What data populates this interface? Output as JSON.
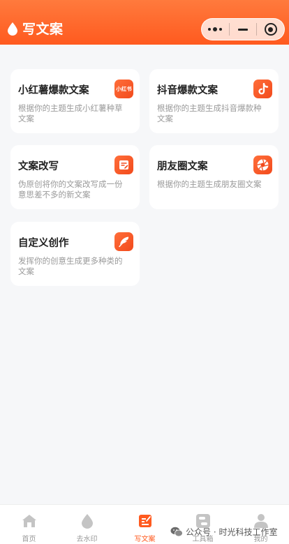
{
  "header": {
    "title": "写文案",
    "logo_icon": "water-drop-icon",
    "capsule": {
      "more_icon": "more-dots-icon",
      "minimize_icon": "minimize-icon",
      "close_icon": "target-close-icon"
    }
  },
  "cards": [
    {
      "title": "小红薯爆款文案",
      "desc": "根据你的主题生成小红薯种草文案",
      "icon": "xiaohongshu-icon",
      "icon_text": "小红书"
    },
    {
      "title": "抖音爆款文案",
      "desc": "根据你的主题生成抖音爆款种文案",
      "icon": "douyin-icon"
    },
    {
      "title": "文案改写",
      "desc": "伪原创将你的文案改写成一份意思差不多的新文案",
      "icon": "rewrite-icon"
    },
    {
      "title": "朋友圈文案",
      "desc": "根据你的主题生成朋友圈文案",
      "icon": "moments-icon"
    },
    {
      "title": "自定义创作",
      "desc": "发挥你的创意生成更多种类的文案",
      "icon": "feather-icon"
    }
  ],
  "tabbar": {
    "items": [
      {
        "label": "首页",
        "icon": "home-icon",
        "active": false
      },
      {
        "label": "去水印",
        "icon": "water-drop-icon",
        "active": false
      },
      {
        "label": "写文案",
        "icon": "write-icon",
        "active": true
      },
      {
        "label": "工具箱",
        "icon": "toolbox-icon",
        "active": false
      },
      {
        "label": "我的",
        "icon": "user-icon",
        "active": false
      }
    ]
  },
  "watermark": {
    "text": "公众号 · 时光科技工作室",
    "icon": "wechat-icon"
  },
  "colors": {
    "accent": "#ff5a1f",
    "header_gradient_start": "#ff7a3d",
    "background": "#f6f7f9",
    "inactive": "#bbbbbb"
  }
}
